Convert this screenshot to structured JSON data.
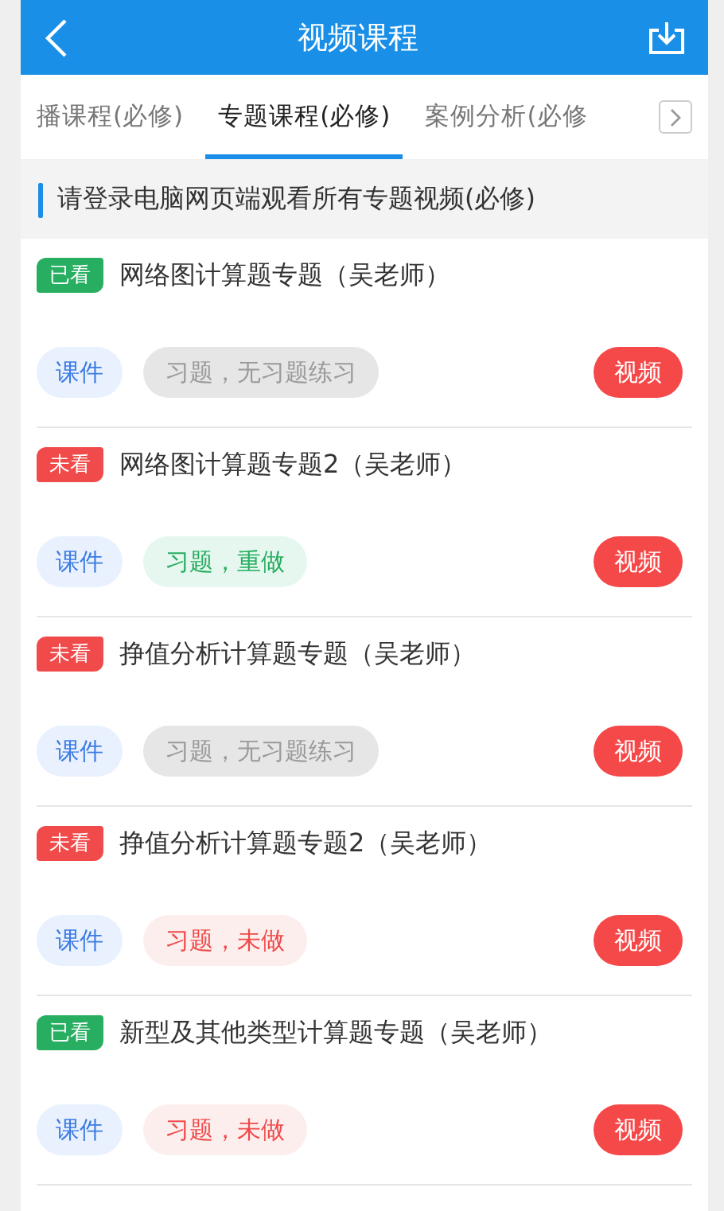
{
  "header": {
    "title": "视频课程"
  },
  "tabs": [
    {
      "label": "播课程(必修)",
      "selected": false
    },
    {
      "label": "专题课程(必修)",
      "selected": true
    },
    {
      "label": "案例分析(必修",
      "selected": false
    }
  ],
  "notice": "请登录电脑网页端观看所有专题视频(必修)",
  "courses": [
    {
      "watched": true,
      "status": "已看",
      "title": "网络图计算题专题（吴老师）",
      "courseware": "课件",
      "exercise": {
        "kind": "none",
        "label": "习题，无习题练习"
      },
      "video": "视频"
    },
    {
      "watched": false,
      "status": "未看",
      "title": "网络图计算题专题2（吴老师）",
      "courseware": "课件",
      "exercise": {
        "kind": "redo",
        "label": "习题，重做"
      },
      "video": "视频"
    },
    {
      "watched": false,
      "status": "未看",
      "title": "挣值分析计算题专题（吴老师）",
      "courseware": "课件",
      "exercise": {
        "kind": "none",
        "label": "习题，无习题练习"
      },
      "video": "视频"
    },
    {
      "watched": false,
      "status": "未看",
      "title": "挣值分析计算题专题2（吴老师）",
      "courseware": "课件",
      "exercise": {
        "kind": "todo",
        "label": "习题，未做"
      },
      "video": "视频"
    },
    {
      "watched": true,
      "status": "已看",
      "title": "新型及其他类型计算题专题（吴老师）",
      "courseware": "课件",
      "exercise": {
        "kind": "todo",
        "label": "习题，未做"
      },
      "video": "视频"
    }
  ]
}
